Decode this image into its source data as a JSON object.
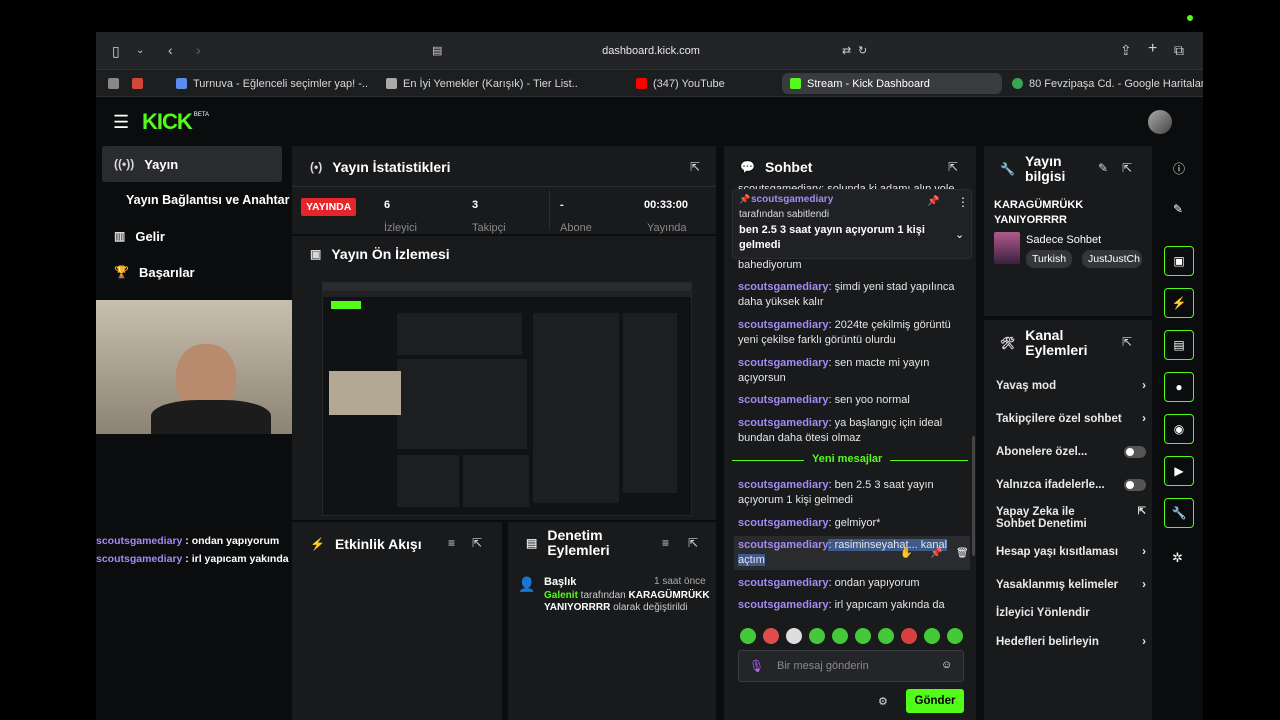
{
  "browser": {
    "url": "dashboard.kick.com",
    "tabs": [
      {
        "label": "Turnuva - Eğlenceli seçimler yap! -...",
        "active": false
      },
      {
        "label": "En İyi Yemekler (Karışık) - Tier List...",
        "active": false
      },
      {
        "label": "(347) YouTube",
        "active": false
      },
      {
        "label": "Stream - Kick Dashboard",
        "active": true
      },
      {
        "label": "80 Fevzipaşa Cd. - Google Haritalar",
        "active": false
      }
    ]
  },
  "logo": {
    "text": "KICK",
    "badge": "BETA"
  },
  "sidebar": {
    "items": [
      {
        "label": "Yayın",
        "icon": "broadcast-icon"
      },
      {
        "label": "Yayın Bağlantısı ve Anahtar",
        "icon": ""
      },
      {
        "label": "Gelir",
        "icon": "chart-icon"
      },
      {
        "label": "Başarılar",
        "icon": "trophy-icon"
      }
    ]
  },
  "stats": {
    "title": "Yayın İstatistikleri",
    "live_badge": "YAYINDA",
    "items": [
      {
        "value": "6",
        "label": "İzleyici"
      },
      {
        "value": "3",
        "label": "Takipçi"
      },
      {
        "value": "-",
        "label": "Abone"
      },
      {
        "value": "00:33:00",
        "label": "Yayında"
      }
    ]
  },
  "preview": {
    "title": "Yayın Ön İzlemesi"
  },
  "overlay_chat": [
    {
      "user": "scoutsgamediary",
      "text": " : ondan yapıyorum"
    },
    {
      "user": "scoutsgamediary",
      "text": " : irl yapıcam yakında da"
    }
  ],
  "activity": {
    "title": "Etkinlik Akışı"
  },
  "moderation": {
    "title": "Denetim Eylemleri",
    "entry": {
      "heading": "Başlık",
      "time": "1 saat önce",
      "actor": "Galenit",
      "text1": " tarafından ",
      "value": "KARAGÜMRÜKK YANIYORRRR",
      "text2": " olarak değiştirildi"
    }
  },
  "chat": {
    "title": "Sohbet",
    "top_cut": "scoutsgamediary: solunda ki adamı alıp vole",
    "pinned": {
      "user": "scoutsgamediary",
      "by": "tarafından sabitlendi",
      "text": "ben 2.5 3 saat yayın açıyorum 1 kişi gelmedi"
    },
    "messages_before": [
      {
        "user": "",
        "text": "bahediyorum"
      },
      {
        "user": "scoutsgamediary",
        "text": ": şimdi yeni stad yapılınca daha yüksek kalır"
      },
      {
        "user": "scoutsgamediary",
        "text": ": 2024te çekilmiş görüntü yeni çekilse farklı görüntü olurdu"
      },
      {
        "user": "scoutsgamediary",
        "text": ": sen macte mi yayın açıyorsun"
      },
      {
        "user": "scoutsgamediary",
        "text": ": sen yoo normal"
      },
      {
        "user": "scoutsgamediary",
        "text": ": ya başlangıç için ideal bundan daha ötesi olmaz"
      }
    ],
    "new_messages_label": "Yeni mesajlar",
    "messages_after": [
      {
        "user": "scoutsgamediary",
        "text": ": ben 2.5 3 saat yayın açıyorum 1 kişi gelmedi"
      },
      {
        "user": "scoutsgamediary",
        "text": ": gelmiyor*"
      },
      {
        "user": "scoutsgamediary",
        "text": ": rasiminseyahat... kanal açtım"
      },
      {
        "user": "scoutsgamediary",
        "text": ": ondan yapıyorum"
      },
      {
        "user": "scoutsgamediary",
        "text": ": irl yapıcam yakında da"
      }
    ],
    "input_placeholder": "Bir mesaj gönderin",
    "send_label": "Gönder"
  },
  "stream_info": {
    "title": "Yayın bilgisi",
    "stream_title": "KARAGÜMRÜKK YANIYORRRR",
    "category": "Sadece Sohbet",
    "tags": [
      "Turkish",
      "JustJustCh"
    ]
  },
  "channel_actions": {
    "title": "Kanal Eylemleri",
    "items": [
      {
        "label": "Yavaş mod",
        "control": "chevron"
      },
      {
        "label": "Takipçilere özel sohbet",
        "control": "chevron"
      },
      {
        "label": "Abonelere özel...",
        "control": "toggle"
      },
      {
        "label": "Yalnızca ifadelerle...",
        "control": "toggle"
      },
      {
        "label": "Yapay Zeka ile Sohbet Denetimi",
        "control": "external"
      },
      {
        "label": "Hesap yaşı kısıtlaması",
        "control": "chevron"
      },
      {
        "label": "Yasaklanmış kelimeler",
        "control": "chevron"
      },
      {
        "label": "İzleyici Yönlendir",
        "control": "none"
      },
      {
        "label": "Hedefleri belirleyin",
        "control": "chevron"
      }
    ]
  },
  "colors": {
    "accent": "#53fc18",
    "username": "#a48af4",
    "live": "#e5252a"
  }
}
